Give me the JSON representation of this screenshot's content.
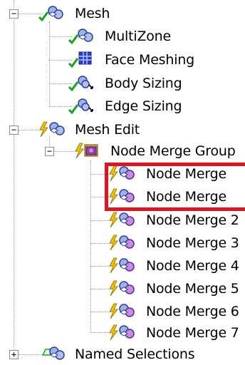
{
  "tree": {
    "mesh": "Mesh",
    "multizone": "MultiZone",
    "face_meshing": "Face Meshing",
    "body_sizing": "Body Sizing",
    "edge_sizing": "Edge Sizing",
    "mesh_edit": "Mesh Edit",
    "node_merge_group": "Node Merge Group",
    "node_merge_a": "Node Merge",
    "node_merge_b": "Node Merge",
    "node_merge_2": "Node Merge 2",
    "node_merge_3": "Node Merge 3",
    "node_merge_4": "Node Merge 4",
    "node_merge_5": "Node Merge 5",
    "node_merge_6": "Node Merge 6",
    "node_merge_7": "Node Merge 7",
    "named_selections": "Named Selections"
  },
  "expander": {
    "minus": "−",
    "plus": "+"
  },
  "colors": {
    "highlight": "#e0141e",
    "check": "#1aa31a",
    "lightning": "#f2c500",
    "mesh_blue": "#3a5bd0"
  }
}
